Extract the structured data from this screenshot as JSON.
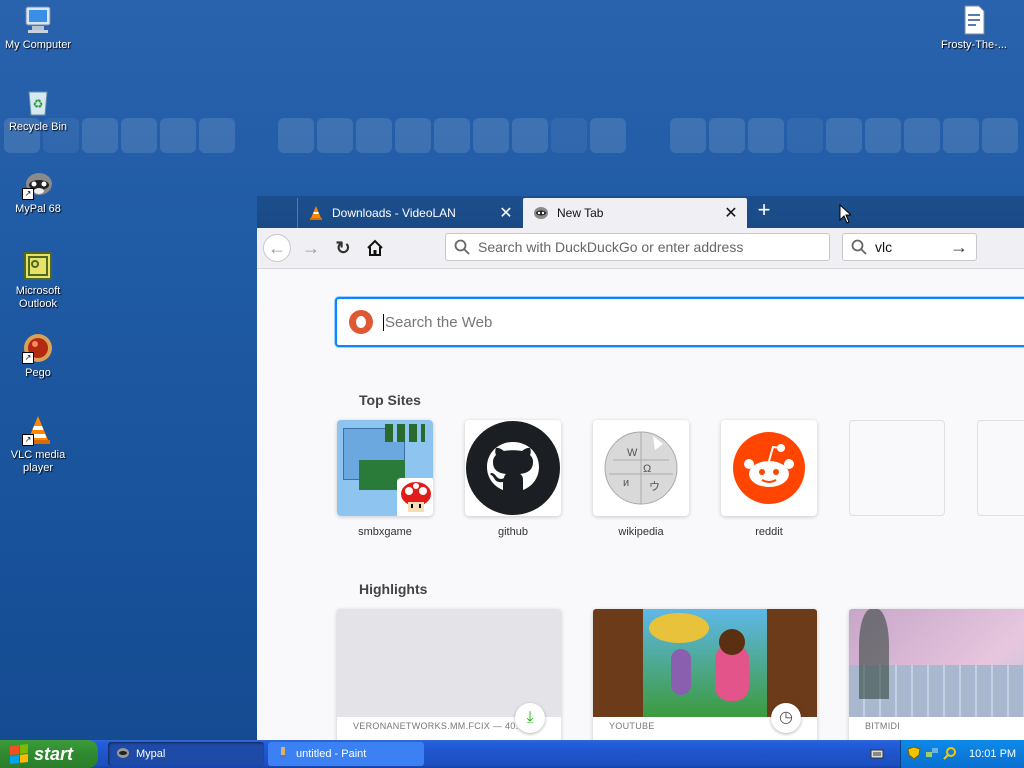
{
  "desktop": {
    "icons": [
      {
        "label": "My Computer",
        "icon": "my-computer-icon"
      },
      {
        "label": "Recycle Bin",
        "icon": "recycle-bin-icon"
      },
      {
        "label": "MyPal 68",
        "icon": "mypal-icon"
      },
      {
        "label": "Microsoft Outlook",
        "icon": "outlook-icon"
      },
      {
        "label": "Pego",
        "icon": "pego-icon"
      },
      {
        "label": "VLC media player",
        "icon": "vlc-icon"
      },
      {
        "label": "Frosty-The-...",
        "icon": "document-icon"
      }
    ]
  },
  "browser": {
    "tabs": [
      {
        "title": "Downloads - VideoLAN",
        "icon": "vlc-cone-icon",
        "active": false
      },
      {
        "title": "New Tab",
        "icon": "mypal-icon",
        "active": true
      }
    ],
    "urlbar": {
      "placeholder": "Search with DuckDuckGo or enter address"
    },
    "searchbar": {
      "value": "vlc"
    },
    "newtab_page": {
      "search_placeholder": "Search the Web",
      "top_sites_title": "Top Sites",
      "top_sites": [
        {
          "name": "smbxgame"
        },
        {
          "name": "github"
        },
        {
          "name": "wikipedia"
        },
        {
          "name": "reddit"
        },
        {
          "name": ""
        },
        {
          "name": ""
        }
      ],
      "highlights_title": "Highlights",
      "highlights": [
        {
          "source": "VERONANETWORKS.MM.FCIX — 40.8 MB",
          "badge": "download-icon"
        },
        {
          "source": "YOUTUBE",
          "badge": "clock-icon"
        },
        {
          "source": "BITMIDI",
          "badge": ""
        }
      ]
    }
  },
  "taskbar": {
    "start_label": "start",
    "tasks": [
      {
        "label": "Mypal",
        "active": true
      },
      {
        "label": "untitled - Paint",
        "active": false
      }
    ],
    "clock": "10:01 PM"
  },
  "colors": {
    "accent": "#0a84ff",
    "reddit": "#ff4500",
    "ddg": "#de5833",
    "xp_green": "#2f8a2f"
  }
}
